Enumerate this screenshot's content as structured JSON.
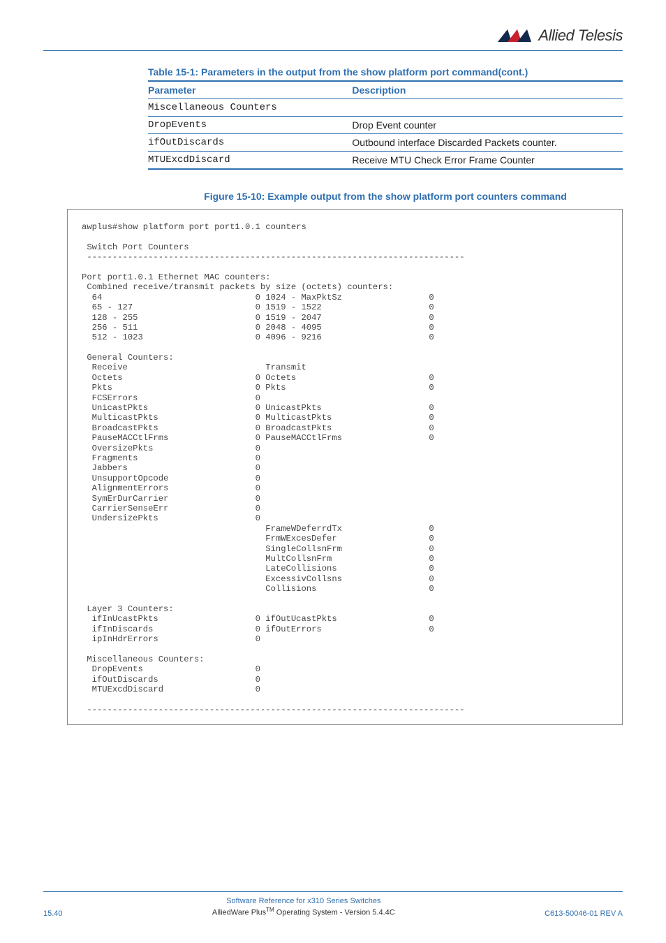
{
  "header": {
    "brand": "Allied Telesis"
  },
  "table": {
    "title": "Table 15-1: Parameters in the output from the show platform port command(cont.)",
    "head_param": "Parameter",
    "head_desc": "Description",
    "rows": [
      {
        "param": "Miscellaneous Counters",
        "desc": ""
      },
      {
        "param": "DropEvents",
        "desc": "Drop Event counter"
      },
      {
        "param": "ifOutDiscards",
        "desc": "Outbound interface Discarded Packets counter."
      },
      {
        "param": "MTUExcdDiscard",
        "desc": "Receive MTU Check Error Frame Counter"
      }
    ]
  },
  "figure": {
    "title": "Figure 15-10: Example output from the show platform port counters command",
    "code": "awplus#show platform port port1.0.1 counters\n\n Switch Port Counters\n --------------------------------------------------------------------------\n\nPort port1.0.1 Ethernet MAC counters:\n Combined receive/transmit packets by size (octets) counters:\n  64                              0 1024 - MaxPktSz                 0\n  65 - 127                        0 1519 - 1522                     0\n  128 - 255                       0 1519 - 2047                     0\n  256 - 511                       0 2048 - 4095                     0\n  512 - 1023                      0 4096 - 9216                     0\n\n General Counters:\n  Receive                           Transmit\n  Octets                          0 Octets                          0\n  Pkts                            0 Pkts                            0\n  FCSErrors                       0\n  UnicastPkts                     0 UnicastPkts                     0\n  MulticastPkts                   0 MulticastPkts                   0\n  BroadcastPkts                   0 BroadcastPkts                   0\n  PauseMACCtlFrms                 0 PauseMACCtlFrms                 0\n  OversizePkts                    0\n  Fragments                       0\n  Jabbers                         0\n  UnsupportOpcode                 0\n  AlignmentErrors                 0\n  SymErDurCarrier                 0\n  CarrierSenseErr                 0\n  UndersizePkts                   0\n                                    FrameWDeferrdTx                 0\n                                    FrmWExcesDefer                  0\n                                    SingleCollsnFrm                 0\n                                    MultCollsnFrm                   0\n                                    LateCollisions                  0\n                                    ExcessivCollsns                 0\n                                    Collisions                      0\n\n Layer 3 Counters:\n  ifInUcastPkts                   0 ifOutUcastPkts                  0\n  ifInDiscards                    0 ifOutErrors                     0\n  ipInHdrErrors                   0\n\n Miscellaneous Counters:\n  DropEvents                      0\n  ifOutDiscards                   0\n  MTUExcdDiscard                  0\n\n --------------------------------------------------------------------------"
  },
  "footer": {
    "left": "15.40",
    "center1": "Software Reference for x310 Series Switches",
    "center2_a": "AlliedWare Plus",
    "center2_b": " Operating System  - Version 5.4.4C",
    "right": "C613-50046-01 REV A"
  }
}
